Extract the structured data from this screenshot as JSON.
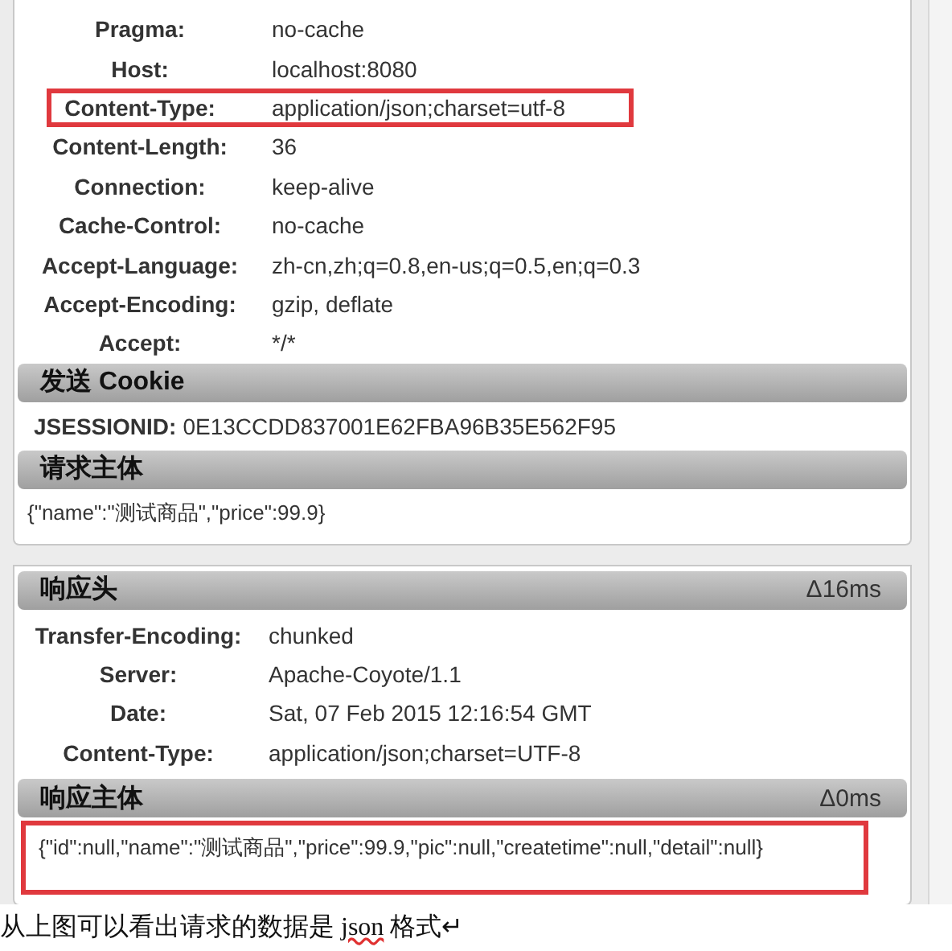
{
  "request_panel": {
    "headers": [
      {
        "name": "Pragma:",
        "value": "no-cache",
        "highlighted": false
      },
      {
        "name": "Host:",
        "value": "localhost:8080",
        "highlighted": false
      },
      {
        "name": "Content-Type:",
        "value": "application/json;charset=utf-8",
        "highlighted": true
      },
      {
        "name": "Content-Length:",
        "value": "36",
        "highlighted": false
      },
      {
        "name": "Connection:",
        "value": "keep-alive",
        "highlighted": false
      },
      {
        "name": "Cache-Control:",
        "value": "no-cache",
        "highlighted": false
      },
      {
        "name": "Accept-Language:",
        "value": "zh-cn,zh;q=0.8,en-us;q=0.5,en;q=0.3",
        "highlighted": false
      },
      {
        "name": "Accept-Encoding:",
        "value": "gzip, deflate",
        "highlighted": false
      },
      {
        "name": "Accept:",
        "value": "*/*",
        "highlighted": false
      }
    ],
    "cookie_section": {
      "title": "发送 Cookie",
      "cookies": [
        {
          "name": "JSESSIONID:",
          "value": "0E13CCDD837001E62FBA96B35E562F95"
        }
      ]
    },
    "body_section": {
      "title": "请求主体",
      "body": "{\"name\":\"测试商品\",\"price\":99.9}",
      "highlighted": false
    }
  },
  "response_panel": {
    "title": "响应头",
    "timing": "Δ16ms",
    "headers": [
      {
        "name": "Transfer-Encoding:",
        "value": "chunked",
        "highlighted": false
      },
      {
        "name": "Server:",
        "value": "Apache-Coyote/1.1",
        "highlighted": false
      },
      {
        "name": "Date:",
        "value": "Sat, 07 Feb 2015 12:16:54 GMT",
        "highlighted": false
      },
      {
        "name": "Content-Type:",
        "value": "application/json;charset=UTF-8",
        "highlighted": false
      }
    ],
    "body_section": {
      "title": "响应主体",
      "timing": "Δ0ms",
      "body": "{\"id\":null,\"name\":\"测试商品\",\"price\":99.9,\"pic\":null,\"createtime\":null,\"detail\":null}",
      "highlighted": true
    }
  },
  "document_text": [
    {
      "text": "从上图可以看出请求的数据是 ",
      "misspelled": false
    },
    {
      "text": "json",
      "misspelled": true
    },
    {
      "text": " 格式↵",
      "misspelled": false
    }
  ]
}
